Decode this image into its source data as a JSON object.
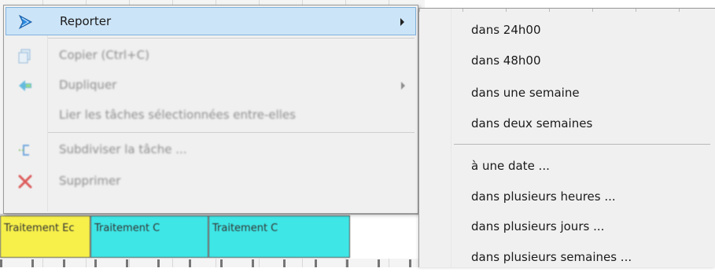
{
  "background": {
    "gantt_bars": [
      {
        "label": "Traitement Ec",
        "color": "#f7f04a"
      },
      {
        "label": "Traitement C",
        "color": "#3ee6e6"
      },
      {
        "label": "Traitement C",
        "color": "#3ee6e6"
      }
    ]
  },
  "context_menu": {
    "items": [
      {
        "label": "Reporter",
        "icon": "forward-arrow-icon",
        "submenu": true,
        "state": "highlighted"
      },
      {
        "label": "Copier (Ctrl+C)",
        "icon": "copy-icon",
        "state": "disabled"
      },
      {
        "label": "Dupliquer",
        "icon": "duplicate-icon",
        "submenu": true,
        "state": "disabled"
      },
      {
        "label": "Lier les tâches sélectionnées entre-elles",
        "state": "disabled"
      },
      {
        "label": "Subdiviser la tâche ...",
        "icon": "split-icon",
        "state": "disabled"
      },
      {
        "label": "Supprimer",
        "icon": "delete-x-icon",
        "state": "disabled"
      }
    ]
  },
  "submenu": {
    "items": [
      {
        "label": "dans 24h00"
      },
      {
        "label": "dans 48h00"
      },
      {
        "label": "dans une semaine"
      },
      {
        "label": "dans deux semaines"
      },
      {
        "label": "à une date ..."
      },
      {
        "label": "dans plusieurs heures ..."
      },
      {
        "label": "dans plusieurs jours ..."
      },
      {
        "label": "dans plusieurs semaines ..."
      }
    ]
  },
  "colors": {
    "menu_bg": "#f0f0f0",
    "highlight": "#cce4f7",
    "highlight_border": "#7fb2de",
    "disabled_text": "#8d8d8d"
  }
}
